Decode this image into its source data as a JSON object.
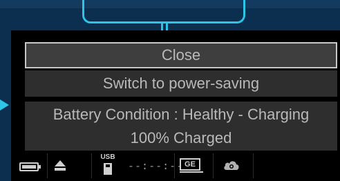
{
  "popup_menu": {
    "close_label": "Close",
    "power_saving_label": "Switch to power-saving",
    "battery_condition": "Battery Condition : Healthy - Charging",
    "charge_status": "100% Charged"
  },
  "status_bar": {
    "usb_label": "USB",
    "time_display": "--:--:--",
    "network_label": "GE",
    "icons": [
      "battery-icon",
      "eject-icon",
      "usb-icon",
      "network-icon",
      "cloud-icon"
    ]
  },
  "colors": {
    "callout_accent": "#2ec4e6",
    "page_background": "#0c2f4f",
    "menu_text": "#b9b9b9",
    "menu_background": "#2e2e2e",
    "selected_border": "#c8c8c8"
  }
}
